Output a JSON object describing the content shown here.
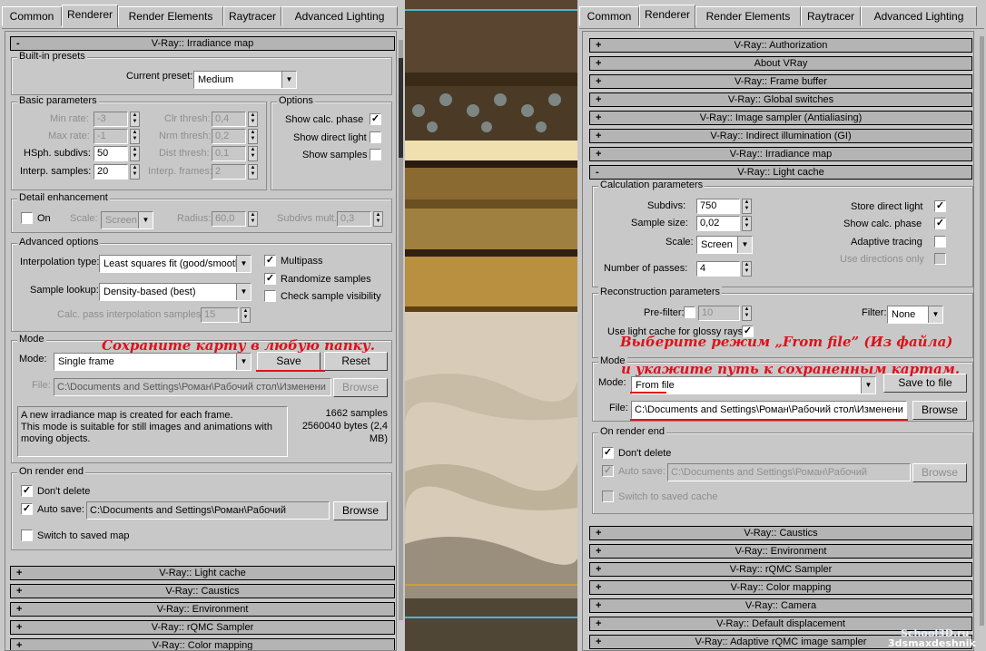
{
  "tabs": {
    "common": "Common",
    "renderer": "Renderer",
    "render_elements": "Render Elements",
    "raytracer": "Raytracer",
    "advanced_lighting": "Advanced Lighting"
  },
  "left": {
    "rollout_title": "V-Ray:: Irradiance map",
    "presets": {
      "group": "Built-in presets",
      "label": "Current preset:",
      "value": "Medium"
    },
    "basic": {
      "group": "Basic parameters",
      "min_rate_label": "Min rate:",
      "min_rate": "-3",
      "max_rate_label": "Max rate:",
      "max_rate": "-1",
      "hsph_label": "HSph. subdivs:",
      "hsph": "50",
      "interp_label": "Interp. samples:",
      "interp": "20",
      "clr_label": "Clr thresh:",
      "clr": "0,4",
      "nrm_label": "Nrm thresh:",
      "nrm": "0,2",
      "dist_label": "Dist thresh:",
      "dist": "0,1",
      "iframes_label": "Interp. frames:",
      "iframes": "2"
    },
    "options": {
      "group": "Options",
      "show_calc": "Show calc. phase",
      "show_direct": "Show direct light",
      "show_samples": "Show samples"
    },
    "detail": {
      "group": "Detail enhancement",
      "on": "On",
      "scale_label": "Scale:",
      "scale": "Screen",
      "radius_label": "Radius:",
      "radius": "60,0",
      "subdivs_label": "Subdivs mult.",
      "subdivs": "0,3"
    },
    "advanced": {
      "group": "Advanced options",
      "interp_type_label": "Interpolation type:",
      "interp_type": "Least squares fit (good/smooth",
      "lookup_label": "Sample lookup:",
      "lookup": "Density-based (best)",
      "calc_label": "Calc. pass interpolation samples:",
      "calc": "15",
      "multipass": "Multipass",
      "randomize": "Randomize samples",
      "check": "Check sample visibility"
    },
    "mode": {
      "group": "Mode",
      "label": "Mode:",
      "value": "Single frame",
      "save": "Save",
      "reset": "Reset",
      "file_label": "File:",
      "file": "C:\\Documents and Settings\\Роман\\Рабочий стол\\Изменени",
      "browse": "Browse",
      "desc1": "A new irradiance map is created for each frame.",
      "desc2": "This mode is suitable for still images and animations with",
      "desc3": "moving objects.",
      "samples": "1662 samples",
      "bytes": "2560040 bytes (2,4",
      "mb": "MB)"
    },
    "render_end": {
      "group": "On render end",
      "dont_delete": "Don't delete",
      "auto_save": "Auto save:",
      "auto_path": "C:\\Documents and Settings\\Роман\\Рабочий",
      "browse": "Browse",
      "switch": "Switch to saved map"
    },
    "rollouts": [
      "V-Ray:: Light cache",
      "V-Ray:: Caustics",
      "V-Ray:: Environment",
      "V-Ray:: rQMC Sampler",
      "V-Ray:: Color mapping"
    ],
    "annotation": "Сохраните карту в любую папку."
  },
  "right": {
    "rollouts_top": [
      "V-Ray:: Authorization",
      "About VRay",
      "V-Ray:: Frame buffer",
      "V-Ray:: Global switches",
      "V-Ray:: Image sampler (Antialiasing)",
      "V-Ray:: Indirect illumination (GI)",
      "V-Ray:: Irradiance map"
    ],
    "rollout_title": "V-Ray:: Light cache",
    "calc": {
      "group": "Calculation parameters",
      "subdivs_label": "Subdivs:",
      "subdivs": "750",
      "size_label": "Sample size:",
      "size": "0,02",
      "scale_label": "Scale:",
      "scale": "Screen",
      "passes_label": "Number of passes:",
      "passes": "4",
      "store": "Store direct light",
      "show_calc": "Show calc. phase",
      "adaptive": "Adaptive tracing",
      "use_dirs": "Use directions only"
    },
    "recon": {
      "group": "Reconstruction parameters",
      "prefilter": "Pre-filter:",
      "prefilter_val": "10",
      "filter_label": "Filter:",
      "filter": "None",
      "glossy": "Use light cache for glossy rays"
    },
    "mode": {
      "group": "Mode",
      "label": "Mode:",
      "value": "From file",
      "save": "Save to file",
      "file_label": "File:",
      "file": "C:\\Documents and Settings\\Роман\\Рабочий стол\\Изменени",
      "browse": "Browse"
    },
    "render_end": {
      "group": "On render end",
      "dont_delete": "Don't delete",
      "auto_save": "Auto save:",
      "auto_path": "C:\\Documents and Settings\\Роман\\Рабочий",
      "browse": "Browse",
      "switch": "Switch to saved cache"
    },
    "rollouts_bottom": [
      "V-Ray:: Caustics",
      "V-Ray:: Environment",
      "V-Ray:: rQMC Sampler",
      "V-Ray:: Color mapping",
      "V-Ray:: Camera",
      "V-Ray:: Default displacement",
      "V-Ray:: Adaptive rQMC image sampler"
    ],
    "annotation1": "Выберите режим „From file” (Из файла)",
    "annotation2": "и укажите путь к сохраненным картам."
  },
  "watermarks": {
    "school": "School3D.ru",
    "site": "3dsmaxdeshnik"
  },
  "colors": {
    "annotation": "#e0101c",
    "panel": "#c8c8c8"
  }
}
